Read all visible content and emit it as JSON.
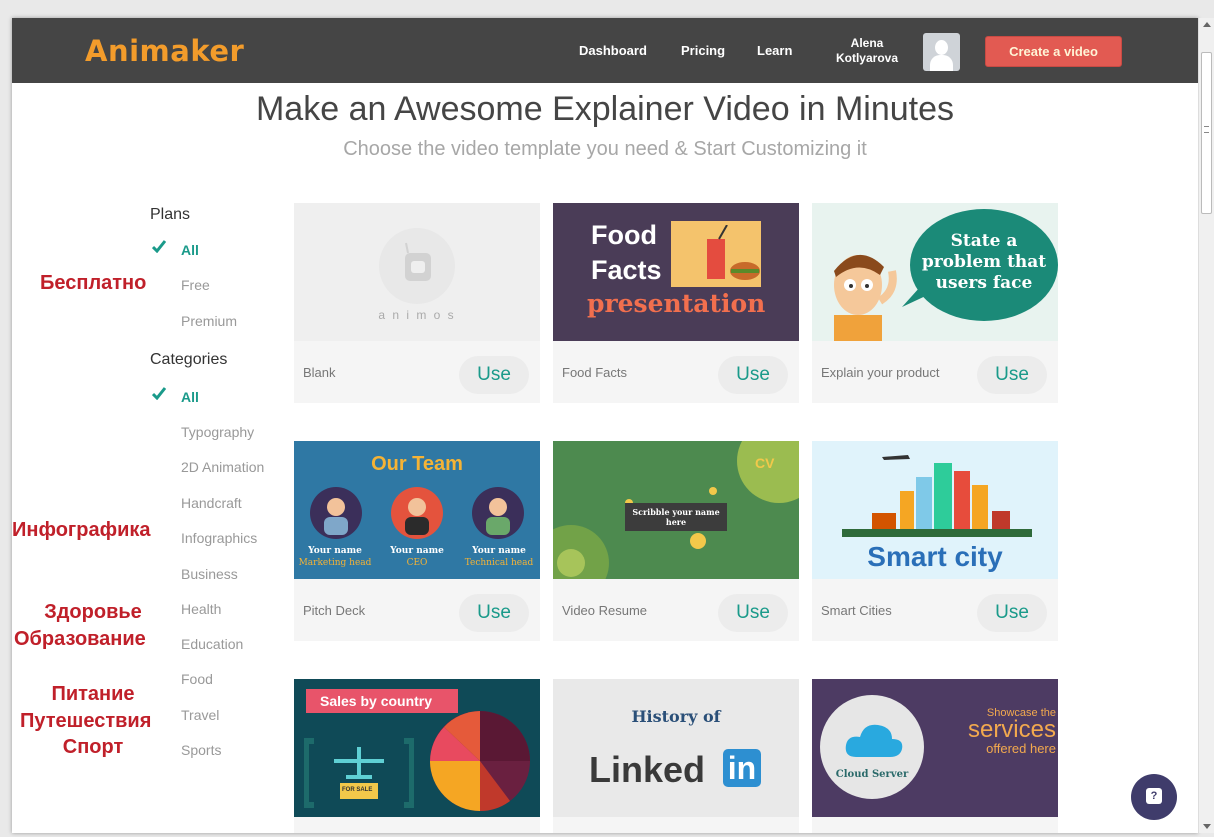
{
  "nav": {
    "logo": "Animaker",
    "links": [
      "Dashboard",
      "Pricing",
      "Learn"
    ],
    "user_first": "Alena",
    "user_last": "Kotlyarova",
    "create_button": "Create a video"
  },
  "hero": {
    "title": "Make an Awesome Explainer Video in Minutes",
    "subtitle": "Choose the video template you need & Start Customizing it"
  },
  "sidebar": {
    "plans_title": "Plans",
    "plans": [
      "All",
      "Free",
      "Premium"
    ],
    "categories_title": "Categories",
    "categories": [
      "All",
      "Typography",
      "2D Animation",
      "Handcraft",
      "Infographics",
      "Business",
      "Health",
      "Education",
      "Food",
      "Travel",
      "Sports"
    ],
    "annotations": {
      "free": "Бесплатно",
      "infographics": "Инфографика",
      "health": "Здоровье",
      "education": "Образование",
      "food": "Питание",
      "travel": "Путешествия",
      "sports": "Спорт"
    }
  },
  "use_label": "Use",
  "cards": [
    {
      "title": "Blank",
      "thumb_text": "a n i m o s"
    },
    {
      "title": "Food Facts",
      "thumb_line1": "Food",
      "thumb_line2": "Facts",
      "thumb_line3": "presentation"
    },
    {
      "title": "Explain your product",
      "thumb_line1": "State a",
      "thumb_line2": "problem that",
      "thumb_line3": "users face"
    },
    {
      "title": "Pitch Deck",
      "thumb_heading": "Our Team",
      "members": [
        {
          "name": "Your name",
          "role": "Marketing head"
        },
        {
          "name": "Your name",
          "role": "CEO"
        },
        {
          "name": "Your name",
          "role": "Technical head"
        }
      ]
    },
    {
      "title": "Video Resume",
      "thumb_cv": "CV",
      "thumb_line1": "Scribble your name",
      "thumb_line2": "here"
    },
    {
      "title": "Smart Cities",
      "thumb_text": "Smart city"
    },
    {
      "title": "",
      "thumb_text": "Sales by country",
      "thumb_sale": "FOR SALE"
    },
    {
      "title": "",
      "thumb_line1": "History of",
      "thumb_line2": "Linked",
      "thumb_line3": "in"
    },
    {
      "title": "",
      "thumb_cloud": "Cloud Server",
      "thumb_line1": "Showcase the",
      "thumb_line2": "services",
      "thumb_line3": "offered here"
    }
  ],
  "help_icon": "question-bubble-icon",
  "colors": {
    "nav_bg": "#454545",
    "logo": "#f39c2b",
    "accent": "#1a9a8a",
    "create_btn": "#e25a52",
    "annotation": "#c0202a"
  }
}
